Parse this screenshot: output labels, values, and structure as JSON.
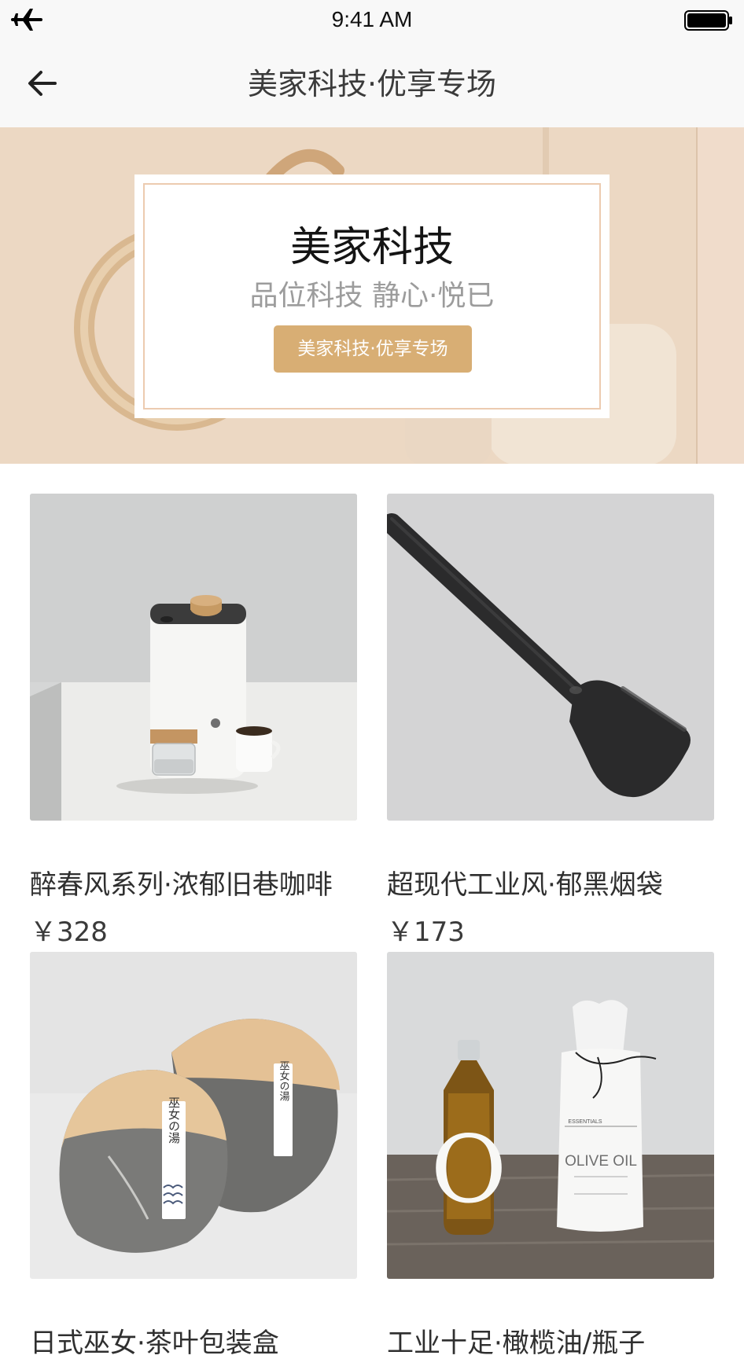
{
  "status_bar": {
    "time": "9:41 AM"
  },
  "nav": {
    "title": "美家科技·优享专场"
  },
  "banner": {
    "title": "美家科技",
    "subtitle": "品位科技 静心·悦已",
    "button_label": "美家科技·优享专场"
  },
  "products": [
    {
      "name": "醉春风系列·浓郁旧巷咖啡",
      "price": "￥328"
    },
    {
      "name": "超现代工业风·郁黑烟袋",
      "price": "￥173"
    },
    {
      "name": "日式巫女·茶叶包装盒",
      "price": ""
    },
    {
      "name": "工业十足·橄榄油/瓶子",
      "price": ""
    }
  ],
  "product_image_text": {
    "bottle_letter": "O",
    "package_brand": "ESSENTIALS",
    "package_label": "OLIVE OIL",
    "tea_tag": "巫女の湯"
  },
  "colors": {
    "bar_background": "#f8f8f8",
    "banner_background": "#ecd8c3",
    "accent_button": "#d8ae74",
    "card_border": "#eccbb0"
  },
  "icons": {
    "status_left": "airplane-icon",
    "status_right": "battery-icon",
    "nav_back": "arrow-left-icon"
  }
}
